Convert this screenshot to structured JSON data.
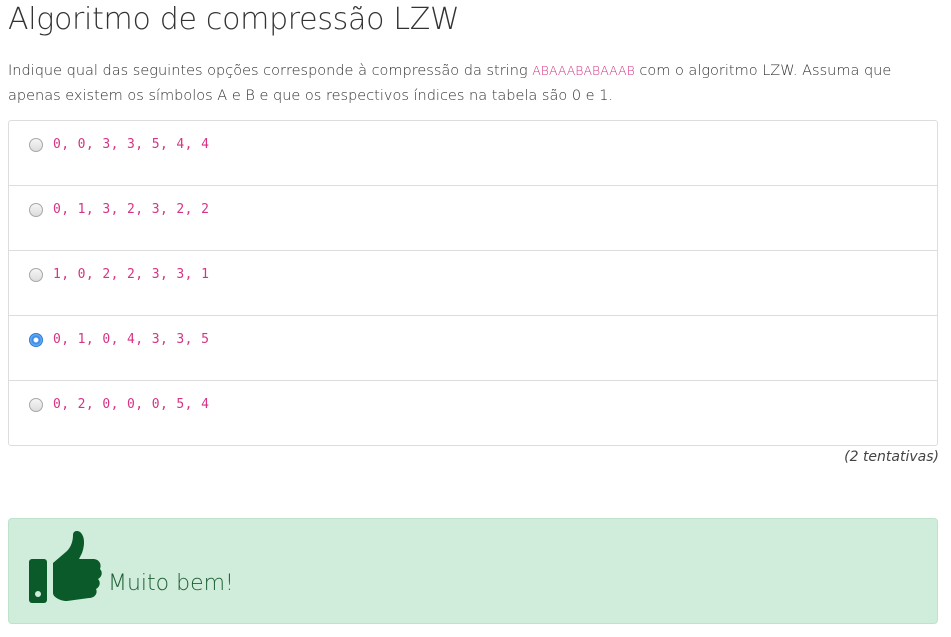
{
  "page": {
    "title": "Algoritmo de compressão LZW",
    "question": {
      "prefix": "Indique qual das seguintes opções corresponde à compressão da string ",
      "code": "ABAAABABAAAB",
      "suffix": " com o algoritmo LZW. Assuma que apenas existem os símbolos A e B e que os respectivos índices na tabela são 0 e 1."
    },
    "options": [
      {
        "label": "0, 0, 3, 3, 5, 4, 4",
        "selected": false
      },
      {
        "label": "0, 1, 3, 2, 3, 2, 2",
        "selected": false
      },
      {
        "label": "1, 0, 2, 2, 3, 3, 1",
        "selected": false
      },
      {
        "label": "0, 1, 0, 4, 3, 3, 5",
        "selected": true
      },
      {
        "label": "0, 2, 0, 0, 0, 5, 4",
        "selected": false
      }
    ],
    "attempts": "(2 tentativas)",
    "feedback": {
      "icon": "thumbs-up-icon",
      "text": "Muito bem!"
    }
  },
  "colors": {
    "code": "#d63384",
    "success_bg": "#d0ecdb",
    "success_text": "#1e5e33",
    "thumb_icon": "#0b5a2a",
    "border": "#dddddd"
  }
}
